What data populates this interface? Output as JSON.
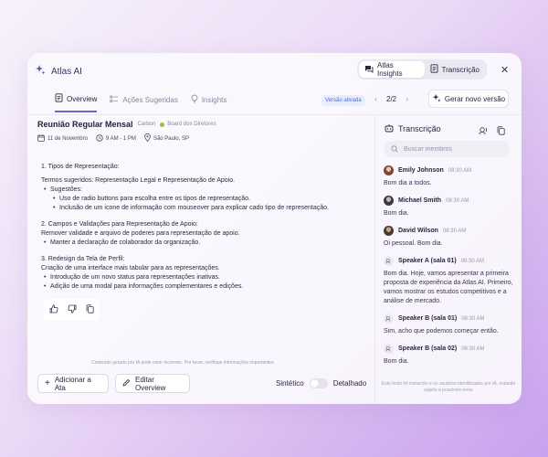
{
  "header": {
    "app_name": "Atlas AI",
    "seg_insights": "Atlas Insights",
    "seg_transcricao": "Transcrição"
  },
  "tabs": [
    {
      "label": "Overview",
      "active": true
    },
    {
      "label": "Ações Sugeridas",
      "active": false
    },
    {
      "label": "Insights",
      "active": false
    }
  ],
  "version": {
    "badge": "Versão ativada",
    "pager": "2/2",
    "new_label": "Gerar novo versão"
  },
  "meeting": {
    "title": "Reunião Regular Mensal",
    "tag": "Carbon",
    "board": "Board dos Diretores",
    "date": "11 de Novembro",
    "time": "9 AM - 1 PM",
    "location": "São Paulo, SP"
  },
  "content": {
    "s1_title": "1. Tipos de Representação:",
    "s1_terms": "Termos sugeridos: Representação Legal e Representação de Apoio.",
    "s1_sug": "Sugestões:",
    "s1_b1": "Uso de radio buttons para escolha entre os tipos de representação.",
    "s1_b2": "Inclusão de um icone de informação com mouseover para explicar cado tipo de representação.",
    "s2_title": "2. Campos e Validações para Representação de Apoio:",
    "s2_line": "Remover validade e arquivo de poderes para representação de apoio.",
    "s2_b1": "Manter a declaração de colaborador da organização.",
    "s3_title": "3. Redesign da Tela de Perfil:",
    "s3_line": "Criação de uma interface mais tabular para as representações.",
    "s3_b1": "Introdução de um novo status para representações inativas.",
    "s3_b2": "Adição de uma modal para informações complementares e edições."
  },
  "disclaimer": "Conteúdo gerado por IA pode estar incorreto. Por favor, verifique informações importantes.",
  "actions": {
    "add_label": "Adicionar a Ata",
    "edit_label": "Editar Overview",
    "toggle_left": "Sintético",
    "toggle_right": "Detalhado"
  },
  "transcript": {
    "title": "Transcrição",
    "search_placeholder": "Buscar membros",
    "messages": [
      {
        "speaker": "Emily Johnson",
        "time": "08:30 AM",
        "text": "Bom dia a todos."
      },
      {
        "speaker": "Michael Smith",
        "time": "08:30 AM",
        "text": "Bom dia."
      },
      {
        "speaker": "David Wilson",
        "time": "08:30 AM",
        "text": "Oi pessoal. Bom dia."
      },
      {
        "speaker": "Speaker A (sala 01)",
        "time": "08:30 AM",
        "text": "Bom dia. Hoje, vamos apresentar a primeira proposta de experiência da Atlas AI. Primeiro, vamos mostrar os estudos competitivos e a análise de mercado."
      },
      {
        "speaker": "Speaker B (sala 01)",
        "time": "08:30 AM",
        "text": "Sim, acho que podemos começar então."
      },
      {
        "speaker": "Speaker B (sala 02)",
        "time": "08:30 AM",
        "text": "Bom dia."
      }
    ],
    "footer": "Este texto foi transcrito e os usuários identificados por IA, estando sujeito a possíveis erros"
  },
  "colors": {
    "accent": "#6f63c9",
    "badge_text": "#4d6ad6",
    "board_dot": "#9bbf4a"
  },
  "icons": [
    "sparkle-icon",
    "message-icon",
    "document-icon",
    "close-icon",
    "overview-icon",
    "list-icon",
    "lightbulb-icon",
    "calendar-icon",
    "clock-icon",
    "location-icon",
    "plus-icon",
    "pencil-icon",
    "thumbs-up-icon",
    "thumbs-down-icon",
    "copy-icon",
    "robot-icon",
    "speaker-icon",
    "search-icon"
  ]
}
